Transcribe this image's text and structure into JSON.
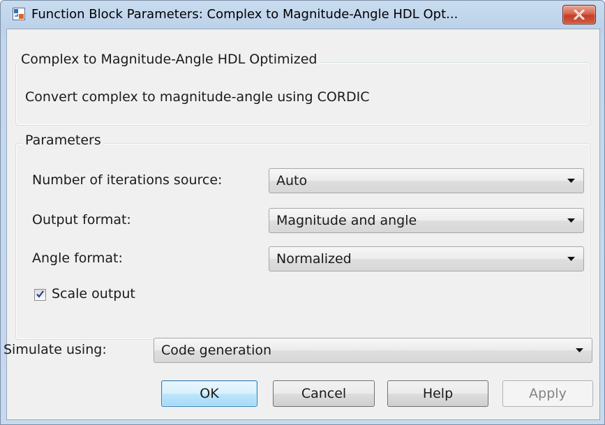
{
  "window": {
    "title": "Function Block Parameters: Complex to Magnitude-Angle HDL Opt..."
  },
  "block": {
    "name": "Complex to Magnitude-Angle HDL Optimized",
    "description": "Convert complex to magnitude-angle using CORDIC"
  },
  "parameters": {
    "legend": "Parameters",
    "iterations_source": {
      "label": "Number of iterations source:",
      "value": "Auto"
    },
    "output_format": {
      "label": "Output format:",
      "value": "Magnitude and angle"
    },
    "angle_format": {
      "label": "Angle format:",
      "value": "Normalized"
    },
    "scale_output": {
      "label": "Scale output",
      "checked": true
    }
  },
  "simulate": {
    "label": "Simulate using:",
    "value": "Code generation"
  },
  "buttons": {
    "ok": "OK",
    "cancel": "Cancel",
    "help": "Help",
    "apply": "Apply"
  },
  "colors": {
    "close_button": "#c2402a",
    "title_bar": "#bcd2ea",
    "dialog_bg": "#f0f0f0",
    "default_button": "#3c7fb1"
  },
  "icons": {
    "app": "simulink-block-icon",
    "close": "close-icon",
    "dropdown": "chevron-down-icon",
    "check": "checkmark-icon"
  }
}
